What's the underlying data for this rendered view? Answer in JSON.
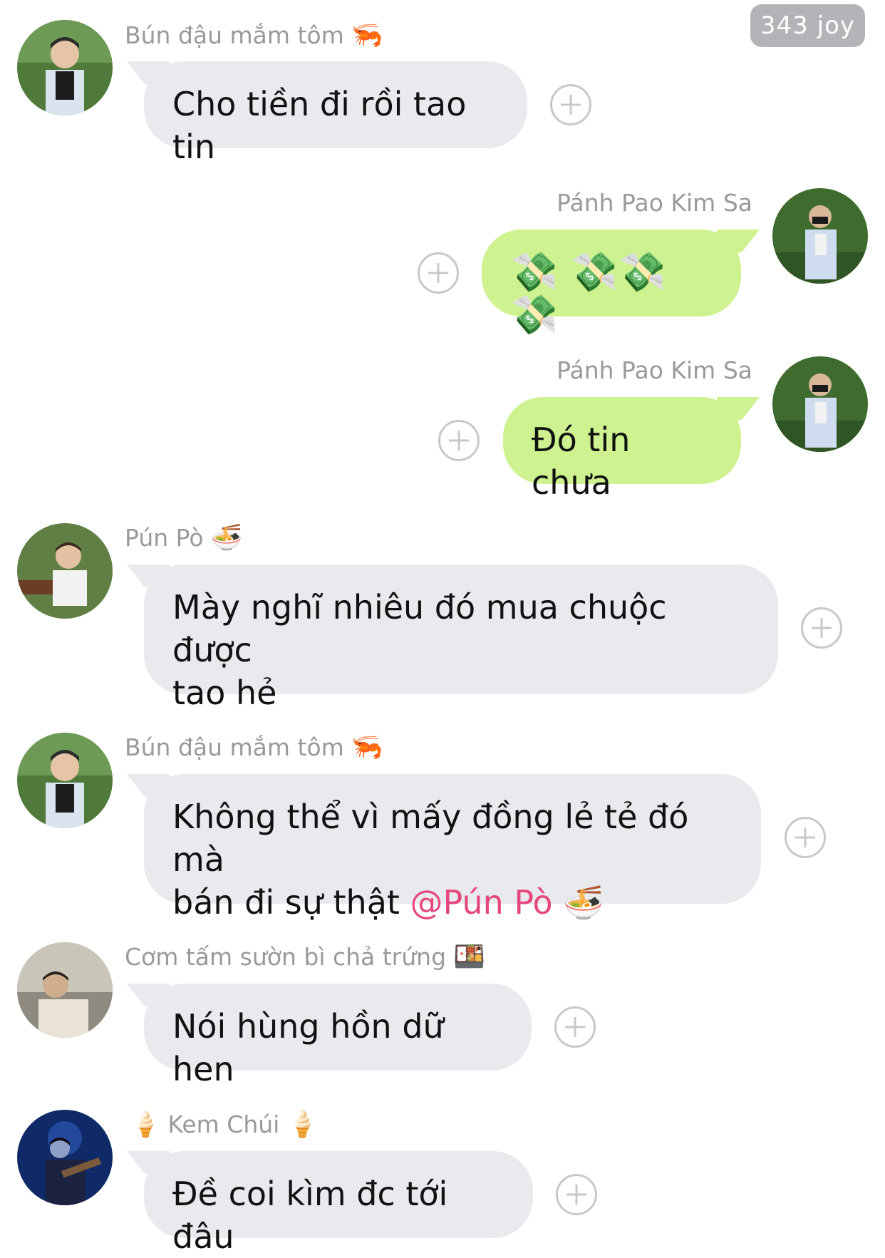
{
  "badge": {
    "label": "343 joy"
  },
  "messages": [
    {
      "sender": "Bún đậu mắm tôm",
      "sender_emoji": "🦐",
      "text": "Cho tiền đi rồi tao tin",
      "side": "left"
    },
    {
      "sender": "Pánh Pao Kim Sa",
      "text": "💸 💸💸💸",
      "side": "right"
    },
    {
      "sender": "Pánh Pao Kim Sa",
      "text": "Đó tin chưa",
      "side": "right"
    },
    {
      "sender": "Pún Pò",
      "sender_emoji": "🍜",
      "text_line1": "Mày nghĩ nhiêu đó mua chuộc được",
      "text_line2": "tao hẻ",
      "side": "left"
    },
    {
      "sender": "Bún đậu mắm tôm",
      "sender_emoji": "🦐",
      "text_line1": "Không thể vì mấy đồng lẻ tẻ đó mà",
      "text_line2_prefix": "bán đi sự thật ",
      "mention": "@Pún Pò",
      "mention_emoji": "🍜",
      "side": "left"
    },
    {
      "sender": "Cơm tấm sườn bì chả trứng",
      "sender_emoji": "🍱",
      "text": "Nói hùng hồn dữ hen",
      "side": "left"
    },
    {
      "sender": "Kem Chúi",
      "sender_emoji_pre": "🍦",
      "sender_emoji": "🍦",
      "text": "Đề coi kìm đc tới đâu",
      "side": "left"
    }
  ],
  "colors": {
    "incoming_bubble": "#e9eaed",
    "outgoing_bubble": "#cdf28f",
    "mention": "#e5487e",
    "badge": "#b4b4b8"
  },
  "icons": {
    "add_reaction": "plus-circle-icon"
  }
}
